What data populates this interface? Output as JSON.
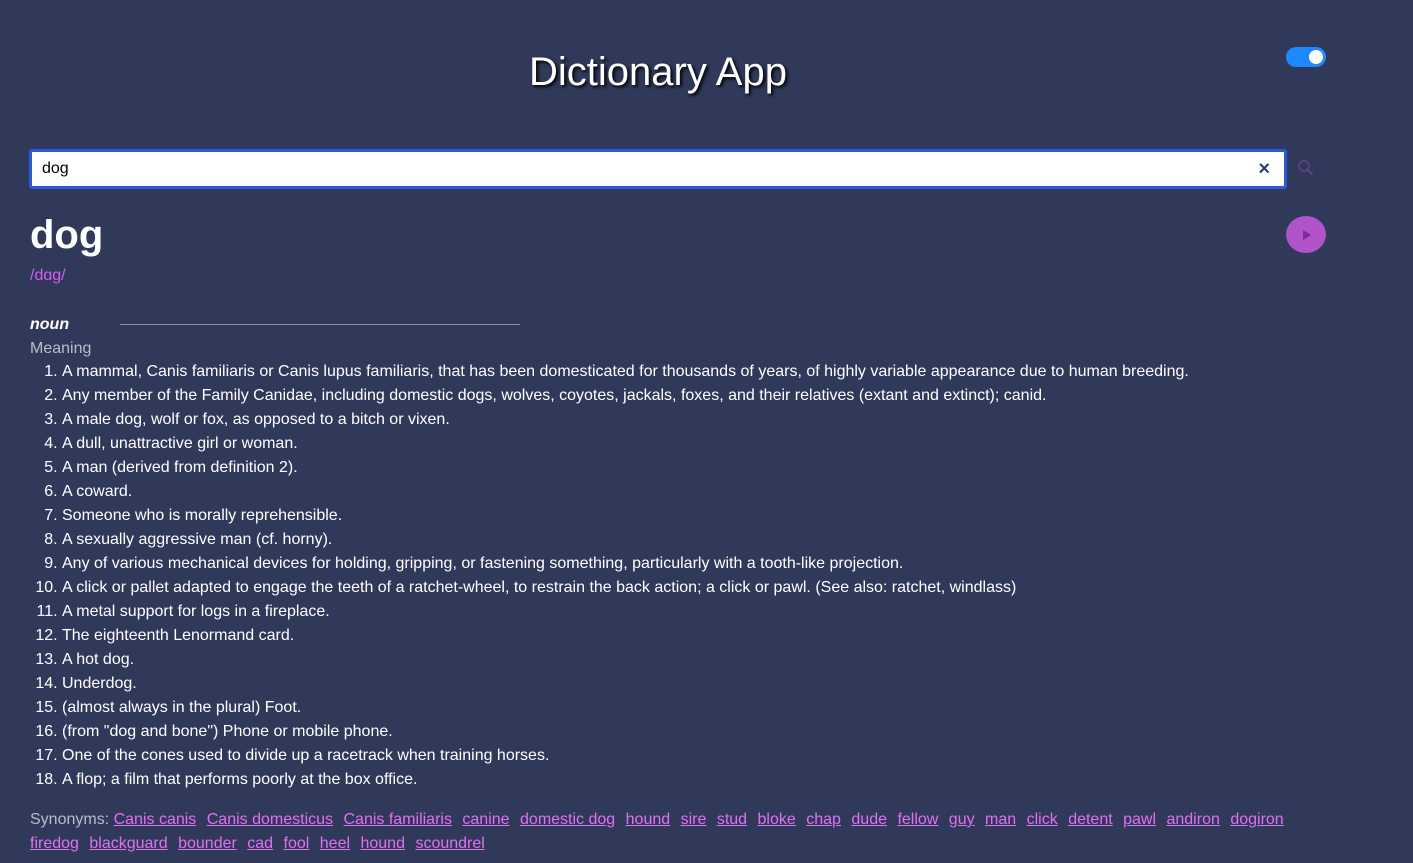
{
  "header": {
    "title": "Dictionary App"
  },
  "theme_toggle": {
    "state": "on",
    "color": "#1e88ff"
  },
  "search": {
    "value": "dog",
    "clear_icon": "×"
  },
  "result": {
    "word": "dog",
    "phonetic": "/dɑɡ/",
    "part_of_speech": "noun",
    "meaning_label": "Meaning",
    "definitions": [
      "A mammal, Canis familiaris or Canis lupus familiaris, that has been domesticated for thousands of years, of highly variable appearance due to human breeding.",
      "Any member of the Family Canidae, including domestic dogs, wolves, coyotes, jackals, foxes, and their relatives (extant and extinct); canid.",
      "A male dog, wolf or fox, as opposed to a bitch or vixen.",
      "A dull, unattractive girl or woman.",
      "A man (derived from definition 2).",
      "A coward.",
      "Someone who is morally reprehensible.",
      "A sexually aggressive man (cf. horny).",
      "Any of various mechanical devices for holding, gripping, or fastening something, particularly with a tooth-like projection.",
      "A click or pallet adapted to engage the teeth of a ratchet-wheel, to restrain the back action; a click or pawl. (See also: ratchet, windlass)",
      "A metal support for logs in a fireplace.",
      "The eighteenth Lenormand card.",
      "A hot dog.",
      "Underdog.",
      "(almost always in the plural) Foot.",
      "(from \"dog and bone\") Phone or mobile phone.",
      "One of the cones used to divide up a racetrack when training horses.",
      "A flop; a film that performs poorly at the box office."
    ],
    "synonyms_label": "Synonyms:",
    "synonyms": [
      "Canis canis",
      "Canis domesticus",
      "Canis familiaris",
      "canine",
      "domestic dog",
      "hound",
      "sire",
      "stud",
      "bloke",
      "chap",
      "dude",
      "fellow",
      "guy",
      "man",
      "click",
      "detent",
      "pawl",
      "andiron",
      "dogiron",
      "firedog",
      "blackguard",
      "bounder",
      "cad",
      "fool",
      "heel",
      "hound",
      "scoundrel"
    ]
  },
  "colors": {
    "background": "#30395a",
    "accent": "#d65cf0",
    "play_button": "#b153c9"
  }
}
